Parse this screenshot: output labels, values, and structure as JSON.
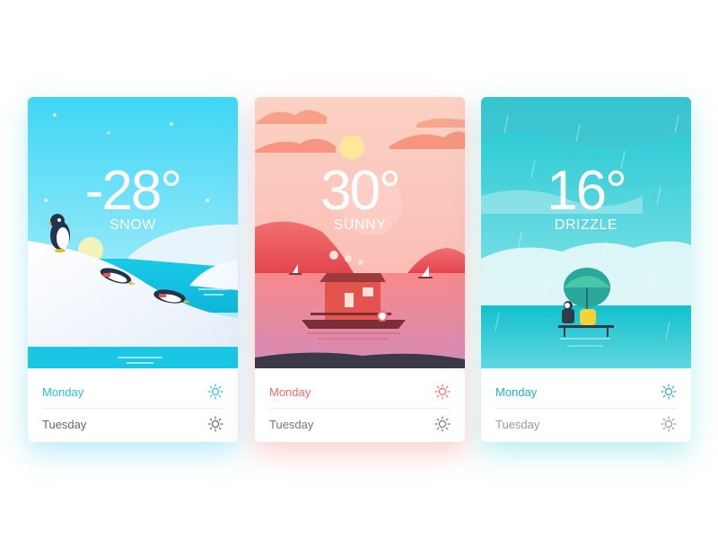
{
  "cards": [
    {
      "temperature": "-28°",
      "condition": "SNOW",
      "accent": "#2bbfe4",
      "days": [
        {
          "day": "Monday",
          "icon": "sun-icon",
          "color": "#2bbfe4"
        },
        {
          "day": "Tuesday",
          "icon": "sun-icon",
          "color": "#666666"
        }
      ]
    },
    {
      "temperature": "30°",
      "condition": "SUNNY",
      "accent": "#f26b6b",
      "days": [
        {
          "day": "Monday",
          "icon": "sun-icon",
          "color": "#f26b6b"
        },
        {
          "day": "Tuesday",
          "icon": "sun-icon",
          "color": "#777777"
        }
      ]
    },
    {
      "temperature": "16°",
      "condition": "DRIZZLE",
      "accent": "#1fb3c4",
      "days": [
        {
          "day": "Monday",
          "icon": "sun-icon",
          "color": "#1fb3c4"
        },
        {
          "day": "Tuesday",
          "icon": "sun-icon",
          "color": "#999999"
        }
      ]
    }
  ]
}
